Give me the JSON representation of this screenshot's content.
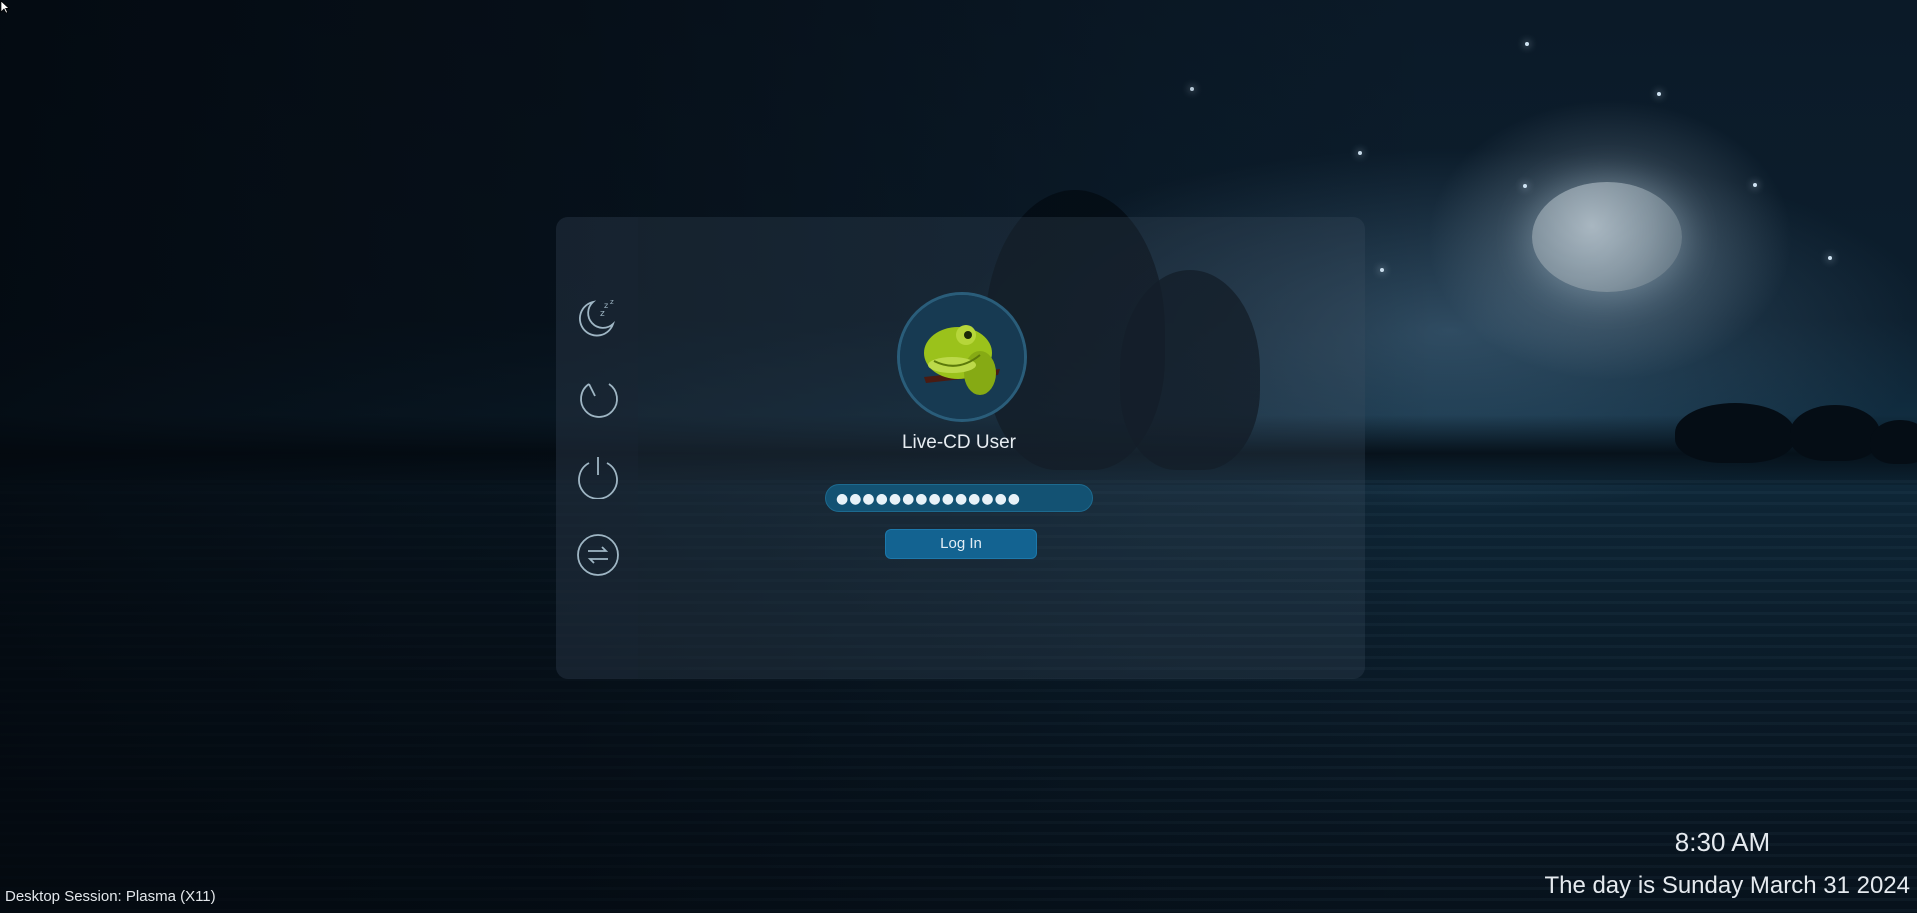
{
  "user": {
    "name": "Live-CD User",
    "avatar_icon": "chameleon-avatar-icon"
  },
  "password": {
    "masked_value": "●●●●●●●●●●●●●●"
  },
  "login_button": {
    "label": "Log In"
  },
  "power_actions": [
    {
      "icon": "sleep-icon"
    },
    {
      "icon": "restart-icon"
    },
    {
      "icon": "shutdown-icon"
    },
    {
      "icon": "switch-user-icon"
    }
  ],
  "session": {
    "label": "Desktop Session: Plasma (X11)"
  },
  "clock": {
    "time": "8:30 AM",
    "date": "The day is Sunday March 31 2024"
  },
  "colors": {
    "accent": "#136391",
    "field": "#135273",
    "panel": "#3c5062"
  }
}
